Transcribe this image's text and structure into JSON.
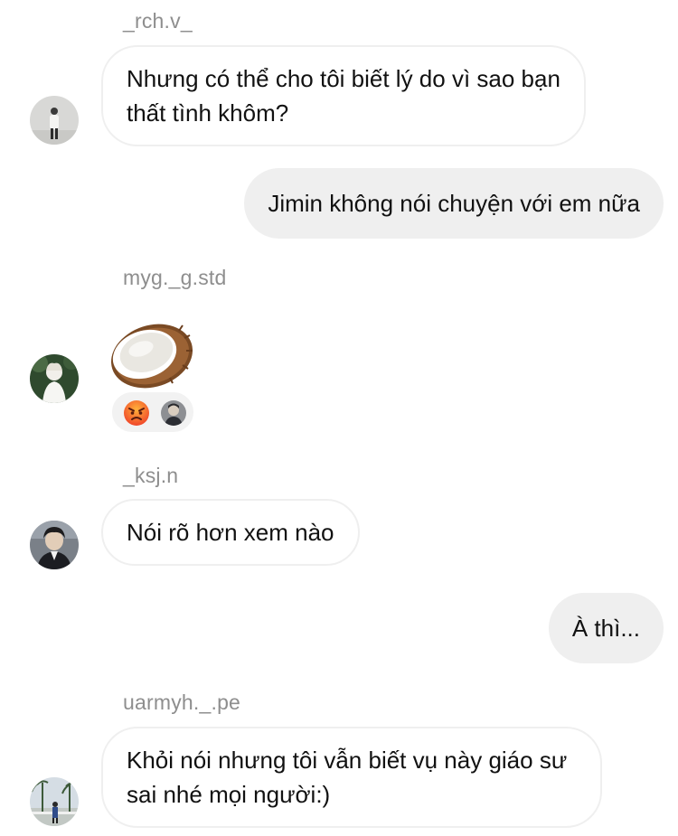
{
  "messages": [
    {
      "sender": "_rch.v_",
      "text": "Nhưng có thể cho tôi biết lý do vì sao bạn thất tình khôm?"
    },
    {
      "sender": "me",
      "text": "Jimin không nói chuyện với em nữa"
    },
    {
      "sender": "myg._g.std",
      "content": "coconut-sticker",
      "reactions": [
        "angry-face-emoji",
        "user-avatar"
      ]
    },
    {
      "sender": "_ksj.n",
      "text": "Nói rõ hơn xem nào"
    },
    {
      "sender": "me",
      "text": "À thì..."
    },
    {
      "sender": "uarmyh._.pe",
      "text": "Khỏi nói nhưng tôi vẫn biết vụ này giáo sư sai nhé mọi người:)"
    }
  ],
  "colors": {
    "outgoing_bubble": "#efefef",
    "incoming_border": "#efefef",
    "username": "#8e8e8e"
  }
}
